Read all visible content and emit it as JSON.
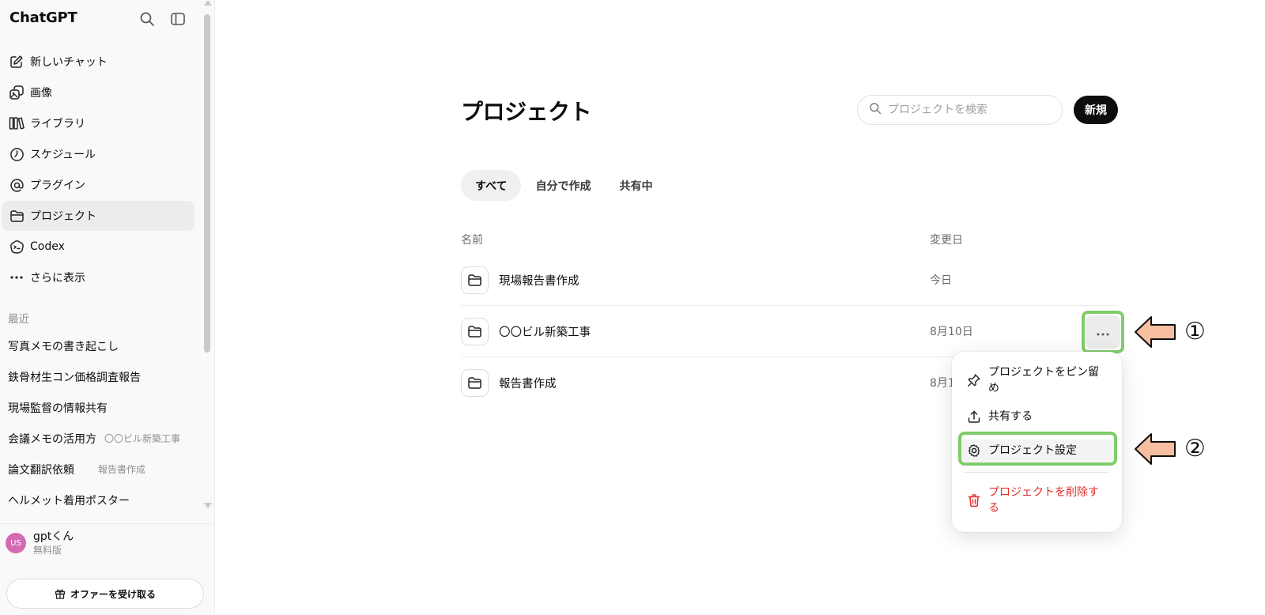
{
  "app": {
    "title": "ChatGPT"
  },
  "sidebar": {
    "nav": [
      {
        "label": "新しいチャット",
        "icon": "edit-icon"
      },
      {
        "label": "画像",
        "icon": "images-icon"
      },
      {
        "label": "ライブラリ",
        "icon": "library-icon"
      },
      {
        "label": "スケジュール",
        "icon": "clock-icon"
      },
      {
        "label": "プラグイン",
        "icon": "at-icon"
      },
      {
        "label": "プロジェクト",
        "icon": "folder-icon",
        "active": true
      },
      {
        "label": "Codex",
        "icon": "codex-icon"
      },
      {
        "label": "さらに表示",
        "icon": "more-icon"
      }
    ],
    "recent_label": "最近",
    "recent": [
      {
        "title": "写真メモの書き起こし",
        "project": ""
      },
      {
        "title": "鉄骨材生コン価格調査報告",
        "project": ""
      },
      {
        "title": "現場監督の情報共有",
        "project": ""
      },
      {
        "title": "会議メモの活用方",
        "project": "〇〇ビル新築工事"
      },
      {
        "title": "論文翻訳依頼",
        "project": "報告書作成"
      },
      {
        "title": "ヘルメット着用ポスター",
        "project": ""
      }
    ],
    "user": {
      "initials": "US",
      "name": "gptくん",
      "plan": "無料版"
    },
    "offer_label": "オファーを受け取る"
  },
  "main": {
    "title": "プロジェクト",
    "search_placeholder": "プロジェクトを検索",
    "new_label": "新規",
    "tabs": [
      "すべて",
      "自分で作成",
      "共有中"
    ],
    "columns": {
      "name": "名前",
      "modified": "変更日"
    },
    "projects": [
      {
        "name": "現場報告書作成",
        "date": "今日"
      },
      {
        "name": "〇〇ビル新築工事",
        "date": "8月10日"
      },
      {
        "name": "報告書作成",
        "date": "8月1"
      }
    ]
  },
  "context_menu": {
    "pin": [
      "プロジェクトをピン留",
      "め"
    ],
    "share": "共有する",
    "settings": "プロジェクト設定",
    "delete": [
      "プロジェクトを削除す",
      "る"
    ]
  },
  "annotations": {
    "step1": "①",
    "step2": "②"
  },
  "colors": {
    "highlight": "#7fcc6a",
    "arrow_fill": "#f7bfa0",
    "danger": "#e02e2a",
    "avatar": "#d36bb3"
  }
}
